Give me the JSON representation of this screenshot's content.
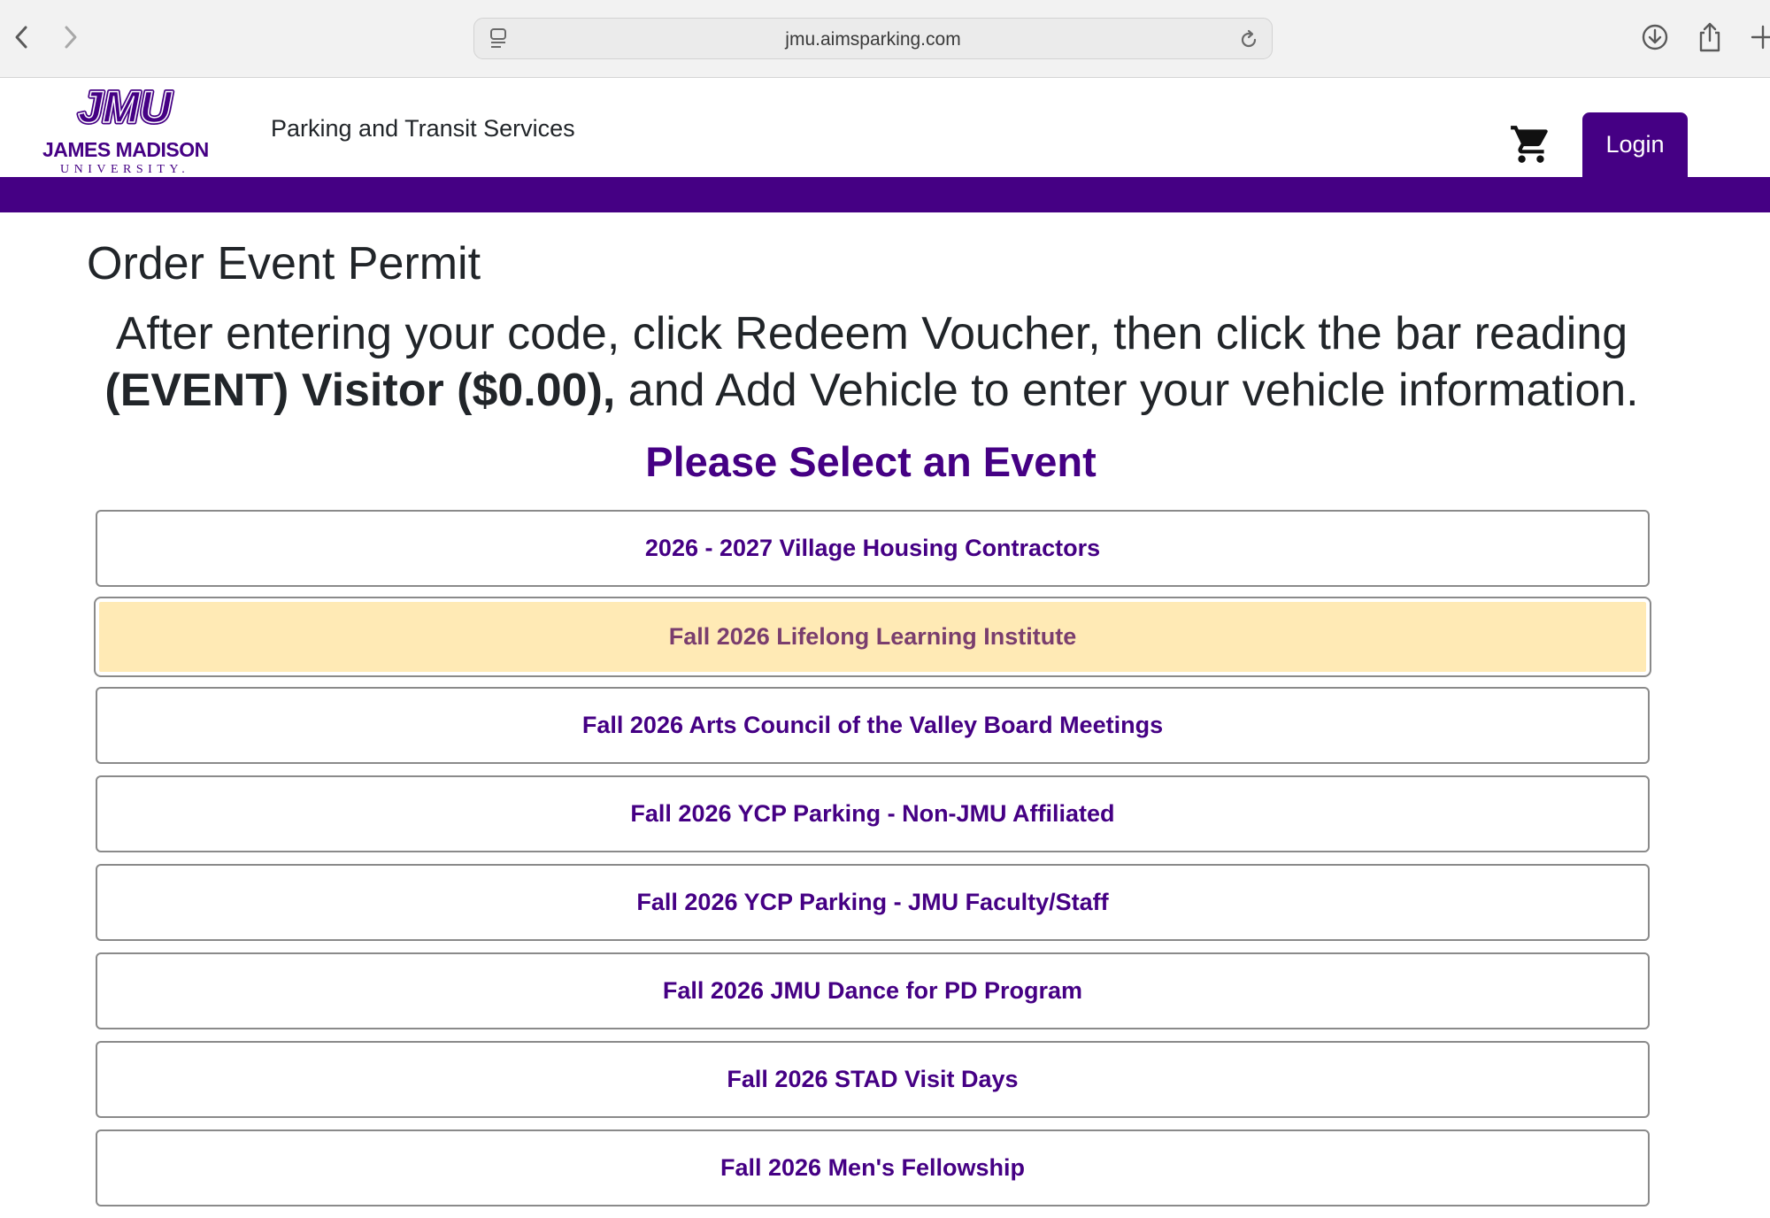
{
  "browser": {
    "url": "jmu.aimsparking.com"
  },
  "header": {
    "logo_text": "JMU",
    "logo_name": "JAMES MADISON",
    "logo_sub": "UNIVERSITY.",
    "department": "Parking and Transit Services",
    "login_label": "Login",
    "brand_color": "#450084"
  },
  "main": {
    "page_title": "Order Event Permit",
    "instructions": {
      "part1": "After entering your code, click Redeem Voucher, then click the bar reading",
      "bold": "(EVENT) Visitor ($0.00),",
      "part2": " and Add Vehicle to enter your vehicle information."
    },
    "select_heading": "Please Select an Event",
    "events": [
      "2026 - 2027 Village Housing Contractors",
      "Fall 2026 Lifelong Learning Institute",
      "Fall 2026 Arts Council of the Valley Board Meetings",
      "Fall 2026 YCP Parking - Non-JMU Affiliated",
      "Fall 2026 YCP Parking - JMU Faculty/Staff",
      "Fall 2026 JMU Dance for PD Program",
      "Fall 2026 STAD Visit Days",
      "Fall 2026 Men's Fellowship"
    ],
    "highlight_color": "#ffeab5"
  }
}
